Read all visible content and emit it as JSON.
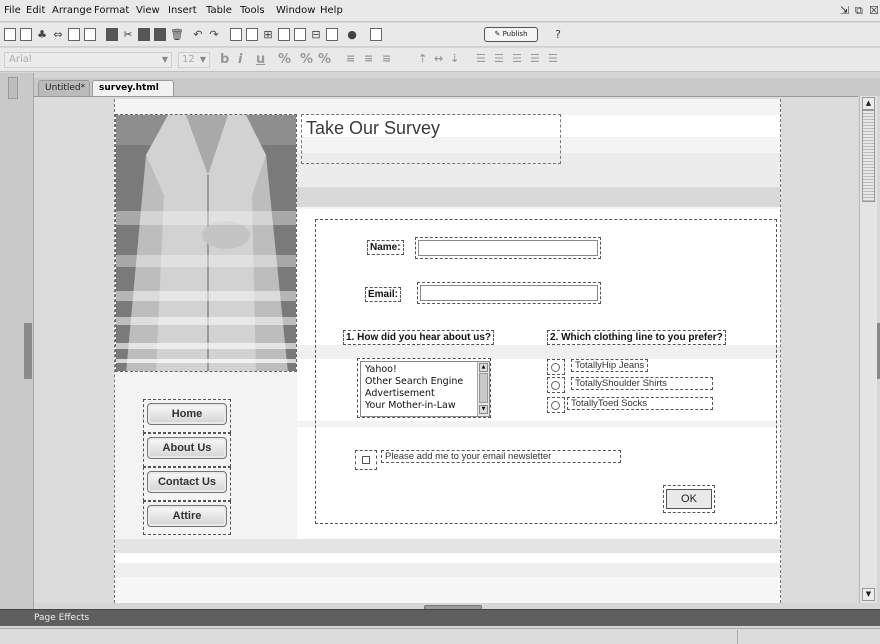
{
  "menubar": {
    "items": [
      {
        "label": "File"
      },
      {
        "label": "Edit"
      },
      {
        "label": "Arrange"
      },
      {
        "label": "Format"
      },
      {
        "label": "View"
      },
      {
        "label": "Insert"
      },
      {
        "label": "Table"
      },
      {
        "label": "Tools"
      },
      {
        "label": "Window"
      },
      {
        "label": "Help"
      }
    ],
    "window_controls": [
      "restore-icon",
      "maximize-icon",
      "close-icon"
    ]
  },
  "toolbar": {
    "publish_label": "Publish",
    "font_family": "Arial",
    "font_size": "12",
    "bold_label": "b",
    "italic_label": "i",
    "underline_label": "u"
  },
  "tabs": [
    {
      "label": "Untitled*"
    },
    {
      "label": "survey.html"
    }
  ],
  "page": {
    "title": "Take Our Survey",
    "form": {
      "name_label": "Name:",
      "email_label": "Email:",
      "question1": "1. How did you hear about us?",
      "question2": "2. Which clothing line to you prefer?",
      "list_options": [
        "Yahoo!",
        "Other Search Engine",
        "Advertisement",
        "Your Mother-in-Law"
      ],
      "radio_options": [
        "TotallyHip Jeans",
        "TotallyShoulder Shirts",
        "TotallyToed Socks"
      ],
      "newsletter_label": "Please add me to your email newsletter",
      "submit_label": "OK"
    },
    "nav": [
      {
        "label": "Home"
      },
      {
        "label": "About Us"
      },
      {
        "label": "Contact Us"
      },
      {
        "label": "Attire"
      }
    ]
  },
  "panels": {
    "page_effects_label": "Page Effects"
  }
}
